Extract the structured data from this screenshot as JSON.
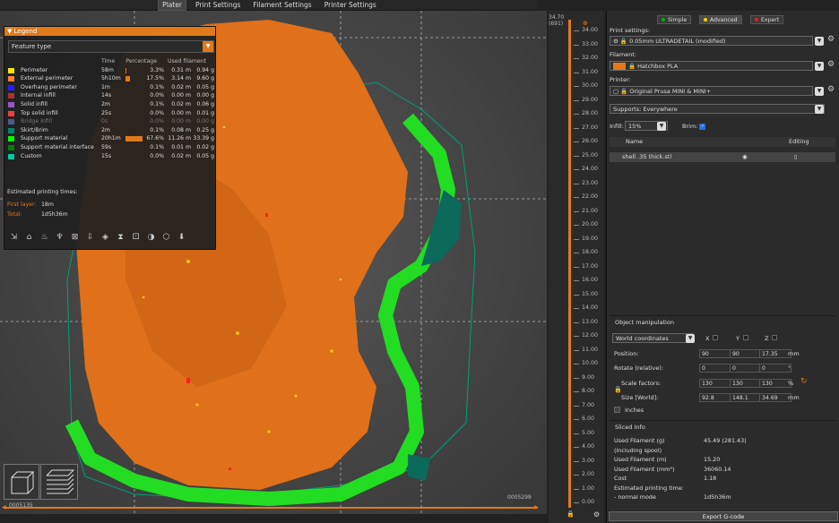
{
  "tabs": [
    "Plater",
    "Print Settings",
    "Filament Settings",
    "Printer Settings"
  ],
  "legend": {
    "title": "Legend",
    "view_type": "Feature type",
    "columns": {
      "time": "Time",
      "percentage": "Percentage",
      "used_filament": "Used filament"
    },
    "rows": [
      {
        "name": "Perimeter",
        "color": "#ffe600",
        "time": "58m",
        "pct": "3.3%",
        "pct_value": 3.3,
        "m": "0.31 m",
        "g": "0.94 g",
        "dim": false
      },
      {
        "name": "External perimeter",
        "color": "#ff7d38",
        "time": "5h10m",
        "pct": "17.5%",
        "pct_value": 17.5,
        "m": "3.14 m",
        "g": "9.60 g",
        "dim": false
      },
      {
        "name": "Overhang perimeter",
        "color": "#1f1fff",
        "time": "1m",
        "pct": "0.1%",
        "pct_value": 0.1,
        "m": "0.02 m",
        "g": "0.05 g",
        "dim": false
      },
      {
        "name": "Internal infill",
        "color": "#b03029",
        "time": "14s",
        "pct": "0.0%",
        "pct_value": 0.0,
        "m": "0.00 m",
        "g": "0.00 g",
        "dim": false
      },
      {
        "name": "Solid infill",
        "color": "#9654cc",
        "time": "2m",
        "pct": "0.1%",
        "pct_value": 0.1,
        "m": "0.02 m",
        "g": "0.06 g",
        "dim": false
      },
      {
        "name": "Top solid infill",
        "color": "#f04040",
        "time": "25s",
        "pct": "0.0%",
        "pct_value": 0.0,
        "m": "0.00 m",
        "g": "0.01 g",
        "dim": false
      },
      {
        "name": "Bridge infill",
        "color": "#4d5b89",
        "time": "0s",
        "pct": "0.0%",
        "pct_value": 0.0,
        "m": "0.00 m",
        "g": "0.00 g",
        "dim": true
      },
      {
        "name": "Skirt/Brim",
        "color": "#00876e",
        "time": "2m",
        "pct": "0.1%",
        "pct_value": 0.1,
        "m": "0.08 m",
        "g": "0.25 g",
        "dim": false
      },
      {
        "name": "Support material",
        "color": "#00ff00",
        "time": "20h1m",
        "pct": "67.6%",
        "pct_value": 67.6,
        "m": "11.26 m",
        "g": "33.39 g",
        "dim": false
      },
      {
        "name": "Support material interface",
        "color": "#008000",
        "time": "59s",
        "pct": "0.1%",
        "pct_value": 0.1,
        "m": "0.01 m",
        "g": "0.02 g",
        "dim": false
      },
      {
        "name": "Custom",
        "color": "#00c8a0",
        "time": "15s",
        "pct": "0.0%",
        "pct_value": 0.0,
        "m": "0.02 m",
        "g": "0.05 g",
        "dim": false
      }
    ],
    "estimated_title": "Estimated printing times:",
    "first_layer_label": "First layer:",
    "first_layer_value": "18m",
    "total_label": "Total:",
    "total_value": "1d5h36m"
  },
  "hslider": {
    "left_value": "0005135",
    "right_value": "0005299"
  },
  "vslider": {
    "top_value": "34.70",
    "top_layer": "(691)",
    "ticks": [
      "34.00",
      "33.00",
      "32.00",
      "31.00",
      "30.00",
      "29.00",
      "28.00",
      "27.00",
      "26.00",
      "25.00",
      "24.00",
      "23.00",
      "22.00",
      "21.00",
      "20.00",
      "19.00",
      "18.00",
      "17.00",
      "16.00",
      "15.00",
      "14.00",
      "13.00",
      "12.00",
      "11.00",
      "10.00",
      "9.00",
      "8.00",
      "7.00",
      "6.00",
      "5.00",
      "4.00",
      "3.00",
      "2.00",
      "1.00",
      "0.00"
    ]
  },
  "panel": {
    "modes": {
      "simple": "Simple",
      "advanced": "Advanced",
      "expert": "Expert"
    },
    "print_settings_label": "Print settings:",
    "print_settings_value": "0.05mm ULTRADETAIL (modified)",
    "filament_label": "Filament:",
    "filament_value": "Hatchbox PLA",
    "filament_color": "#e07a1a",
    "printer_label": "Printer:",
    "printer_value": "Original Prusa MINI & MINI+",
    "supports_label": "Supports:",
    "supports_value": "Everywhere",
    "infill_label": "Infill:",
    "infill_value": "15%",
    "brim_label": "Brim:",
    "object_list": {
      "name_header": "Name",
      "editing_header": "Editing",
      "object_name": "shell .35 thick.stl"
    },
    "manipulation": {
      "title": "Object manipulation",
      "coord_mode": "World coordinates",
      "x": "X",
      "y": "Y",
      "z": "Z",
      "position_label": "Position:",
      "position": [
        "90",
        "90",
        "17.35"
      ],
      "position_unit": "mm",
      "rotate_label": "Rotate (relative):",
      "rotate": [
        "0",
        "0",
        "0"
      ],
      "rotate_unit": "°",
      "scale_label": "Scale factors:",
      "scale": [
        "130",
        "130",
        "130"
      ],
      "scale_unit": "%",
      "size_label": "Size [World]:",
      "size": [
        "92.8",
        "148.1",
        "34.69"
      ],
      "size_unit": "mm",
      "inches_label": "Inches"
    },
    "sliced": {
      "title": "Sliced Info",
      "rows": [
        {
          "k": "Used Filament (g)",
          "v": "45.49 (281.43)"
        },
        {
          "k": "    (including spool)",
          "v": ""
        },
        {
          "k": "Used Filament (m)",
          "v": "15.20"
        },
        {
          "k": "Used Filament (mm³)",
          "v": "36060.14"
        },
        {
          "k": "Cost",
          "v": "1.18"
        },
        {
          "k": "Estimated printing time:",
          "v": ""
        },
        {
          "k": " - normal mode",
          "v": "1d5h36m"
        }
      ]
    },
    "export_label": "Export G-code"
  }
}
